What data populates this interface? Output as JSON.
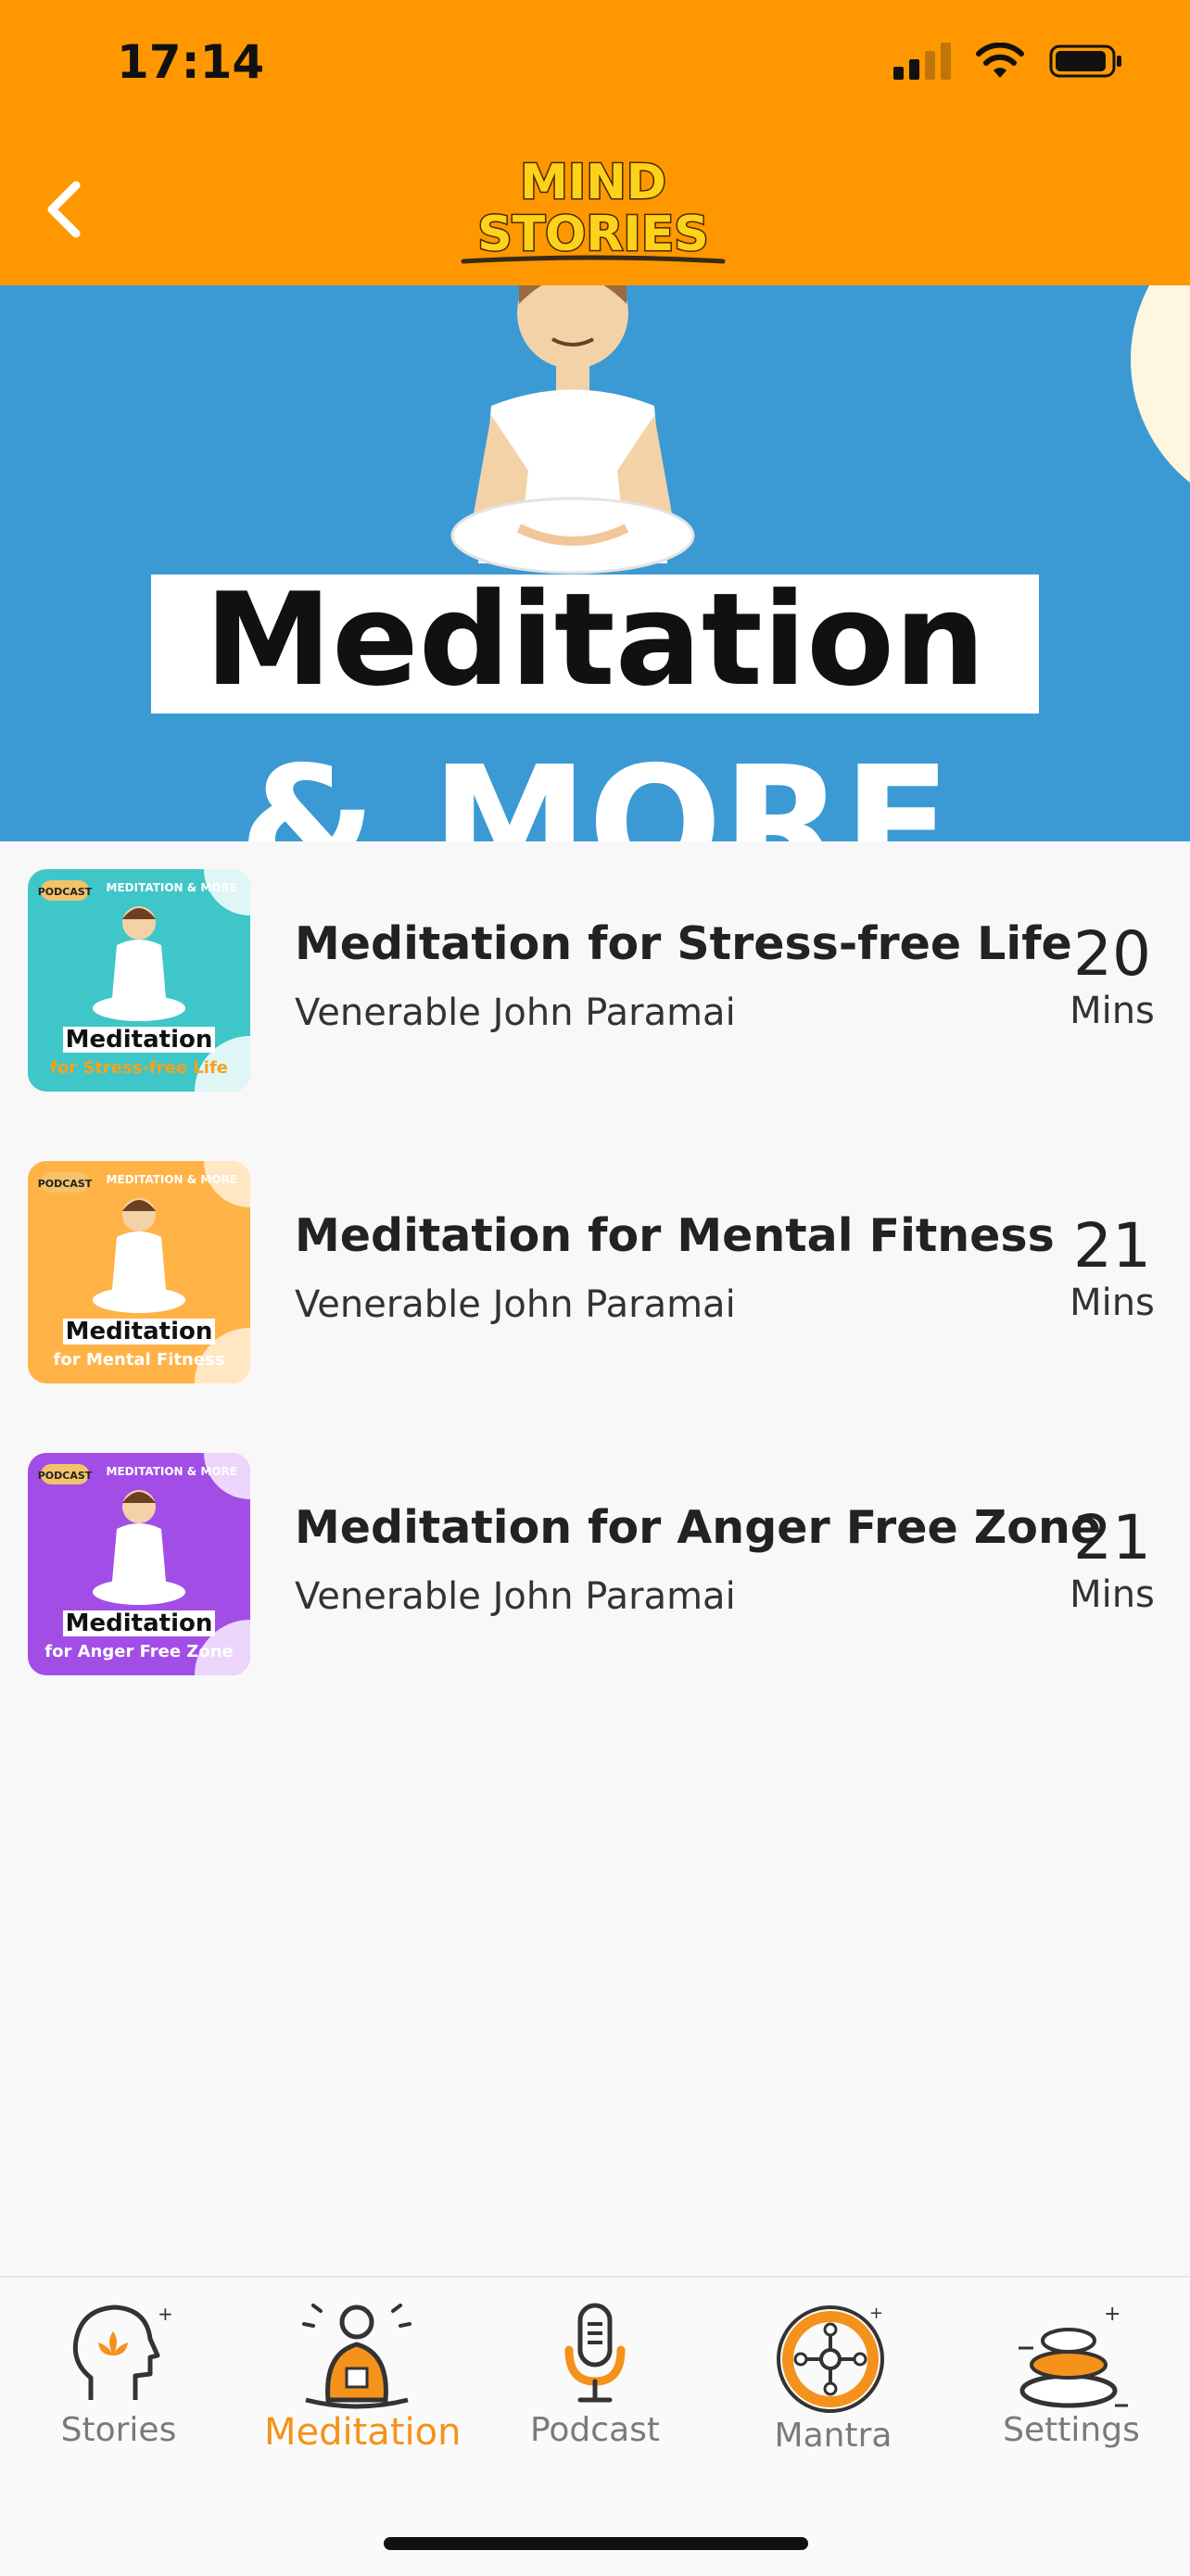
{
  "status_bar": {
    "time": "17:14"
  },
  "header": {
    "logo_line1": "MIND",
    "logo_line2": "STORIES"
  },
  "hero": {
    "title": "Meditation",
    "subtitle": "& MORE"
  },
  "items": [
    {
      "title": "Meditation for Stress-free Life",
      "author": "Venerable John Paramai",
      "duration": "20",
      "unit": "Mins",
      "thumb_badge": "PODCAST",
      "thumb_top": "MEDITATION & MORE",
      "thumb_title": "Meditation",
      "thumb_sub": "for Stress-free Life",
      "thumb_color": "#3fc6c8"
    },
    {
      "title": "Meditation for Mental Fitness",
      "author": "Venerable John Paramai",
      "duration": "21",
      "unit": "Mins",
      "thumb_badge": "PODCAST",
      "thumb_top": "MEDITATION & MORE",
      "thumb_title": "Meditation",
      "thumb_sub": "for Mental Fitness",
      "thumb_color": "#ffb347"
    },
    {
      "title": "Meditation for Anger Free Zone",
      "author": "Venerable John Paramai",
      "duration": "21",
      "unit": "Mins",
      "thumb_badge": "PODCAST",
      "thumb_top": "MEDITATION & MORE",
      "thumb_title": "Meditation",
      "thumb_sub": "for Anger Free Zone",
      "thumb_color": "#a24ee6"
    }
  ],
  "tabs": [
    {
      "label": "Stories",
      "icon": "head-lotus-icon"
    },
    {
      "label": "Meditation",
      "icon": "meditating-person-icon",
      "active": true
    },
    {
      "label": "Podcast",
      "icon": "microphone-icon"
    },
    {
      "label": "Mantra",
      "icon": "mantra-wheel-icon"
    },
    {
      "label": "Settings",
      "icon": "stacked-stones-icon"
    }
  ],
  "colors": {
    "accent": "#ff9800",
    "hero_bg": "#3b9ad3",
    "active_tab": "#f5921b"
  }
}
